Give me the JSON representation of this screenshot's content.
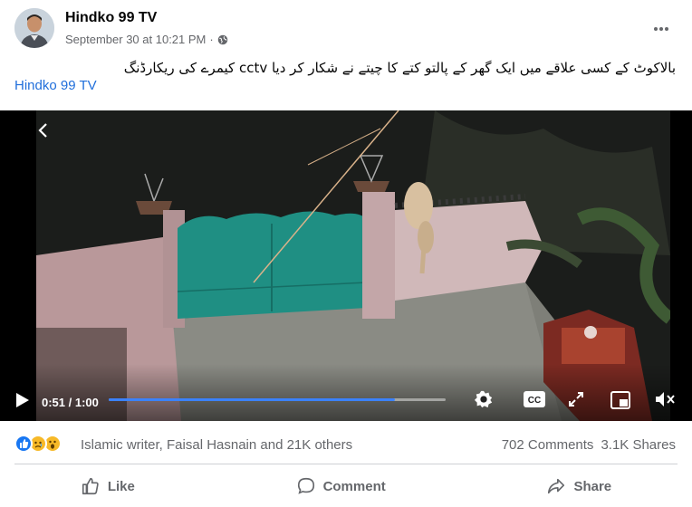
{
  "post": {
    "page_name": "Hindko 99 TV",
    "timestamp": "September 30 at 10:21 PM",
    "separator": "·",
    "privacy_icon": "globe-icon",
    "more_icon": "more-options-icon"
  },
  "caption": {
    "text": "بالاکوٹ کے کسی علاقے میں ایک گھر کے پالتو کتے کا چیتے نے شکار کر دیا cctv کیمرے کی ریکارڈنگ",
    "tag": "Hindko 99 TV"
  },
  "video": {
    "current_time": "0:51",
    "duration": "1:00",
    "time_separator": " / ",
    "progress": 0.85,
    "controls": [
      "back-icon",
      "play-icon",
      "settings-icon",
      "captions-icon",
      "fullscreen-icon",
      "miniplayer-icon",
      "mute-icon"
    ]
  },
  "reactions": {
    "icons": [
      "like-icon",
      "sad-icon",
      "wow-icon"
    ],
    "summary": "Islamic writer, Faisal Hasnain and 21K others",
    "comments": "702 Comments",
    "shares": "3.1K Shares"
  },
  "actions": {
    "like": "Like",
    "comment": "Comment",
    "share": "Share"
  },
  "colors": {
    "link": "#216fdb",
    "secondary_text": "#65676b",
    "progress": "#3b82ff",
    "like_blue": "#1877f2",
    "reaction_yellow": "#f7b928"
  }
}
